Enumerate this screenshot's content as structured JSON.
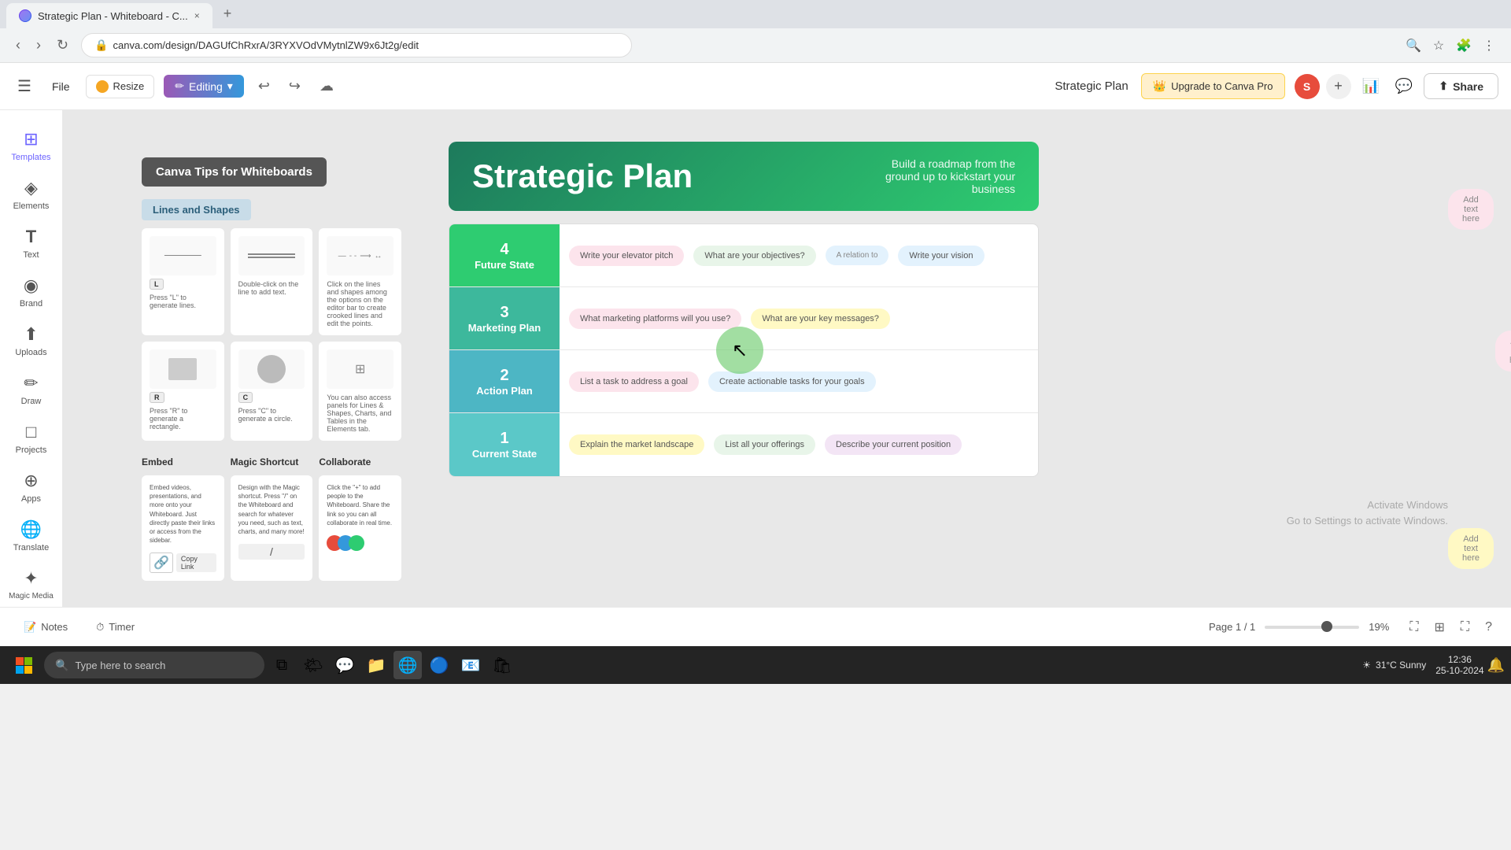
{
  "browser": {
    "tab_title": "Strategic Plan - Whiteboard - C...",
    "url": "canva.com/design/DAGUfChRxrA/3RYXVOdVMytnlZW9x6Jt2g/edit",
    "close_label": "×",
    "new_tab": "+"
  },
  "toolbar": {
    "file_label": "File",
    "resize_label": "Resize",
    "editing_label": "Editing",
    "doc_title": "Strategic Plan",
    "upgrade_label": "Upgrade to Canva Pro",
    "share_label": "Share",
    "avatar_initials": "S"
  },
  "sidebar": {
    "items": [
      {
        "label": "Templates",
        "icon": "⊞"
      },
      {
        "label": "Elements",
        "icon": "◈"
      },
      {
        "label": "Text",
        "icon": "T"
      },
      {
        "label": "Brand",
        "icon": "◉"
      },
      {
        "label": "Uploads",
        "icon": "⬆"
      },
      {
        "label": "Draw",
        "icon": "✏"
      },
      {
        "label": "Projects",
        "icon": "□"
      },
      {
        "label": "Apps",
        "icon": "⊕"
      },
      {
        "label": "Translate",
        "icon": "🌐"
      },
      {
        "label": "Magic Media",
        "icon": "✦"
      }
    ]
  },
  "tips_panel": {
    "title": "Canva Tips for Whiteboards",
    "section1_title": "Lines and Shapes",
    "card1_key": "L",
    "card1_text": "Press \"L\" to generate lines.",
    "card2_text": "Double-click on the line to add text.",
    "card3_text": "Click on the lines and shapes among the options on the editor bar to create crooked lines and edit the points.",
    "card4_key": "R",
    "card4_text": "Press \"R\" to generate a rectangle.",
    "card5_key": "C",
    "card5_text": "Press \"C\" to generate a circle.",
    "card6_text": "You can also access panels for Lines & Shapes, Charts, and Tables in the Elements tab.",
    "embed_label": "Embed",
    "magic_label": "Magic Shortcut",
    "collab_label": "Collaborate"
  },
  "strategic_plan": {
    "title": "Strategic Plan",
    "subtitle": "Build a roadmap from the ground up to kickstart your business",
    "rows": [
      {
        "num": "4",
        "label": "Future State",
        "color": "row-future",
        "bubbles": [
          {
            "text": "Write your elevator pitch",
            "style": "bubble-pink"
          },
          {
            "text": "What are your objectives?",
            "style": "bubble-green"
          },
          {
            "text": "A relation to",
            "style": "bubble-blue"
          },
          {
            "text": "Write your vision",
            "style": "bubble-blue"
          }
        ]
      },
      {
        "num": "3",
        "label": "Marketing Plan",
        "color": "row-marketing",
        "bubbles": [
          {
            "text": "What marketing platforms will you use?",
            "style": "bubble-pink"
          },
          {
            "text": "What are your key messages?",
            "style": "bubble-yellow"
          }
        ]
      },
      {
        "num": "2",
        "label": "Action Plan",
        "color": "row-action",
        "bubbles": [
          {
            "text": "List a task to address a goal",
            "style": "bubble-pink"
          },
          {
            "text": "Create actionable tasks for your goals",
            "style": "bubble-blue"
          }
        ]
      },
      {
        "num": "1",
        "label": "Current State",
        "color": "row-current",
        "bubbles": [
          {
            "text": "Explain the market landscape",
            "style": "bubble-yellow"
          },
          {
            "text": "List all your offerings",
            "style": "bubble-green"
          },
          {
            "text": "Describe your current position",
            "style": "bubble-purple"
          }
        ]
      }
    ],
    "deco_top_right": [
      "Add text here",
      "Add text here"
    ],
    "deco_bottom_right": [
      "Add text here",
      "Add text here"
    ],
    "deco_side": [
      "Add text here",
      "Add text here"
    ]
  },
  "bottom": {
    "notes_label": "Notes",
    "timer_label": "Timer",
    "page_info": "Page 1 / 1",
    "zoom_pct": "19%"
  },
  "taskbar": {
    "search_placeholder": "Type here to search",
    "time": "12:36",
    "date": "25-10-2024",
    "weather": "31°C  Sunny"
  },
  "windows_activate": {
    "line1": "Activate Windows",
    "line2": "Go to Settings to activate Windows."
  }
}
